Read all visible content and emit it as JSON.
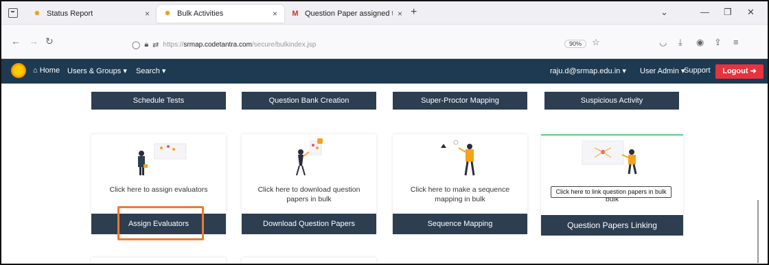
{
  "browser": {
    "tabs": [
      {
        "label": "Status Report",
        "close": "×"
      },
      {
        "label": "Bulk Activities",
        "close": "×"
      },
      {
        "label": "Question Paper assigned to you",
        "close": "×"
      }
    ],
    "new_tab": "+",
    "address": {
      "url_prefix": "https://",
      "url_domain": "srmap.codetantra.com",
      "url_path": "/secure/bulkindex.jsp",
      "zoom": "90%"
    }
  },
  "app": {
    "menu": {
      "home": "Home",
      "users_groups": "Users & Groups",
      "search": "Search",
      "user_email": "raju.d@srmap.edu.in",
      "user_admin": "User Admin",
      "support": "Support",
      "logout": "Logout"
    },
    "accent": "#1e3a52",
    "logout_color": "#e8323c"
  },
  "top_buttons": [
    "Schedule Tests",
    "Question Bank Creation",
    "Super-Proctor Mapping",
    "Suspicious Activity"
  ],
  "cards": [
    {
      "text": "Click here to assign evaluators",
      "button": "Assign Evaluators"
    },
    {
      "text": "Click here to download question papers in bulk",
      "button": "Download Question Papers"
    },
    {
      "text": "Click here to make a sequence mapping in bulk",
      "button": "Sequence Mapping"
    },
    {
      "text": "bulk",
      "button": "Question Papers Linking",
      "tooltip": "Click here to link question papers in bulk"
    }
  ],
  "highlight_color": "#f07b2c"
}
